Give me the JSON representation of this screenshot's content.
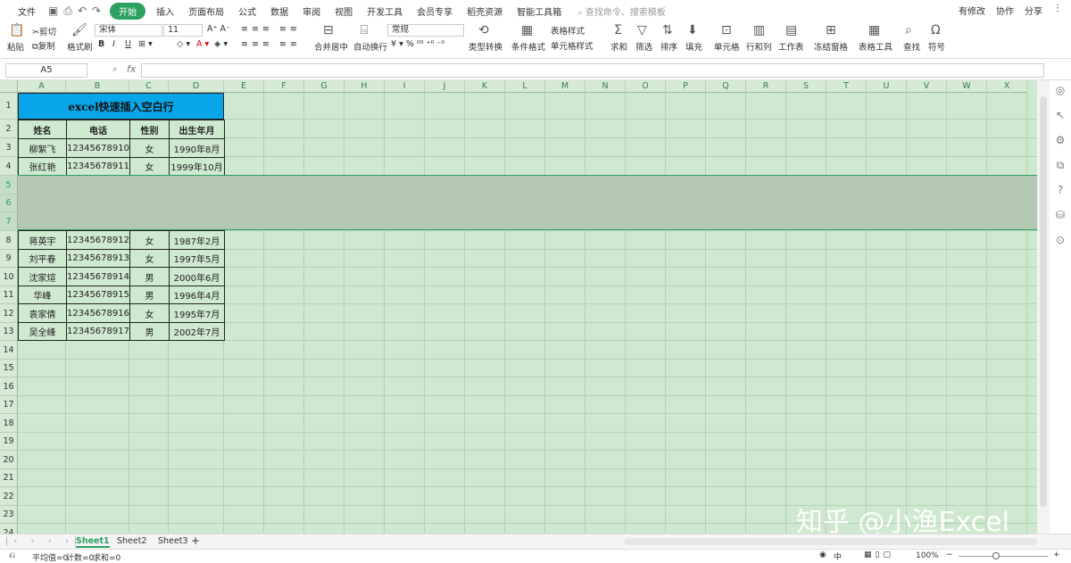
{
  "menubar": {
    "file": "文件",
    "tabs": [
      "开始",
      "插入",
      "页面布局",
      "公式",
      "数据",
      "审阅",
      "视图",
      "开发工具",
      "会员专享",
      "稻壳资源",
      "智能工具箱"
    ],
    "search_placeholder": "查找命令、搜索模板",
    "right": [
      "有修改",
      "协作",
      "分享"
    ]
  },
  "toolbar": {
    "paste": "粘贴",
    "cut": "剪切",
    "copy": "复制",
    "format_painter": "格式刷",
    "font_name": "宋体",
    "font_size": "11",
    "merge_center": "合并居中",
    "wrap_text": "自动换行",
    "number_format": "常规",
    "type_convert": "类型转换",
    "conditional_format": "条件格式",
    "table_style": "表格样式",
    "cell_style": "单元格样式",
    "sum": "求和",
    "filter": "筛选",
    "sort": "排序",
    "fill": "填充",
    "cell": "单元格",
    "row_col": "行和列",
    "worksheet": "工作表",
    "freeze": "冻结窗格",
    "table_tools": "表格工具",
    "find": "查找",
    "symbol": "符号"
  },
  "formula": {
    "name_box": "A5",
    "fx": "fx",
    "value": ""
  },
  "columns": [
    "A",
    "B",
    "C",
    "D",
    "E",
    "F",
    "G",
    "H",
    "I",
    "J",
    "K",
    "L",
    "M",
    "N",
    "O",
    "P",
    "Q",
    "R",
    "S",
    "T",
    "U",
    "V",
    "W",
    "X"
  ],
  "rows": [
    "1",
    "2",
    "3",
    "4",
    "5",
    "6",
    "7",
    "8",
    "9",
    "10",
    "11",
    "12",
    "13",
    "14",
    "15",
    "16",
    "17",
    "18",
    "19",
    "20",
    "21",
    "22",
    "23",
    "24"
  ],
  "sheet": {
    "title": "excel快速插入空白行",
    "headers": [
      "姓名",
      "电话",
      "性别",
      "出生年月"
    ],
    "records": [
      [
        "柳絮飞",
        "12345678910",
        "女",
        "1990年8月"
      ],
      [
        "张红艳",
        "12345678911",
        "女",
        "1999年10月"
      ],
      [
        "",
        "",
        "",
        ""
      ],
      [
        "",
        "",
        "",
        ""
      ],
      [
        "",
        "",
        "",
        ""
      ],
      [
        "蒋英宇",
        "12345678912",
        "女",
        "1987年2月"
      ],
      [
        "刘平春",
        "12345678913",
        "女",
        "1997年5月"
      ],
      [
        "沈家煊",
        "12345678914",
        "男",
        "2000年6月"
      ],
      [
        "华峰",
        "12345678915",
        "男",
        "1996年4月"
      ],
      [
        "袁家倩",
        "12345678916",
        "女",
        "1995年7月"
      ],
      [
        "吴全峰",
        "12345678917",
        "男",
        "2002年7月"
      ]
    ]
  },
  "sheet_tabs": [
    "Sheet1",
    "Sheet2",
    "Sheet3"
  ],
  "status": {
    "avg": "平均值=0",
    "count": "计数=0",
    "sum": "求和=0",
    "zoom": "100%"
  },
  "watermark": "知乎 @小渔Excel"
}
